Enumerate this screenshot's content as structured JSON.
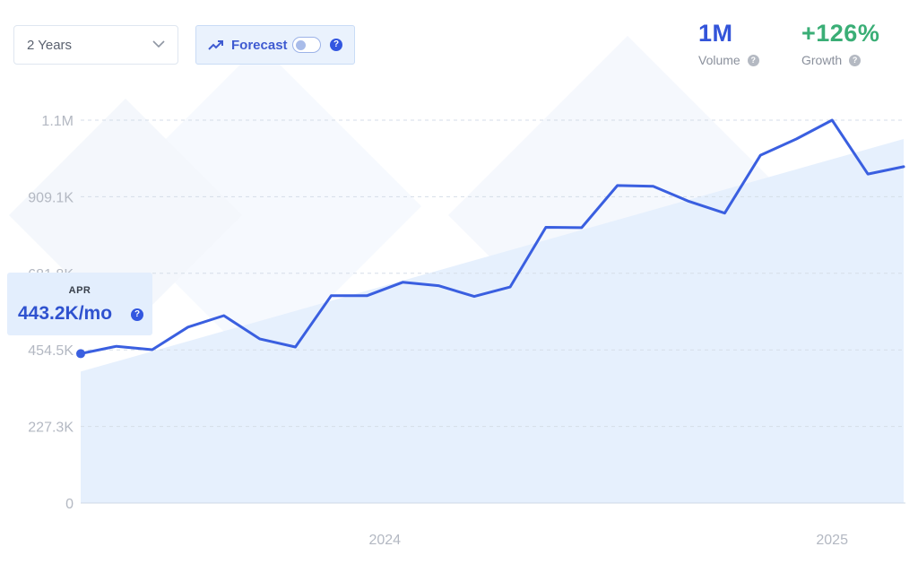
{
  "controls": {
    "range": {
      "selected": "2 Years",
      "icon": "chevron-down-icon"
    },
    "forecast": {
      "label": "Forecast",
      "enabled": false,
      "icon": "trending-up-icon",
      "help": "?"
    }
  },
  "stats": {
    "volume": {
      "value": "1M",
      "label": "Volume",
      "help": "?"
    },
    "growth": {
      "value": "+126%",
      "label": "Growth",
      "help": "?"
    }
  },
  "tooltip": {
    "month": "APR",
    "value": "443.2K/mo",
    "help": "?"
  },
  "colors": {
    "line": "#3a5fe0",
    "area": "#e6f0fd",
    "volume": "#3354d9",
    "growth": "#3aae76"
  },
  "chart_data": {
    "type": "line",
    "y_ticks": [
      "0",
      "227.3K",
      "454.5K",
      "681.8K",
      "909.1K",
      "1.1M"
    ],
    "x_ticks": [
      "2024",
      "2025"
    ],
    "ylim": [
      0,
      1136000
    ],
    "grid": true,
    "trend_area": {
      "start": 390000,
      "end": 1080000
    },
    "series": [
      {
        "values": [
          443200,
          465000,
          455000,
          522000,
          556000,
          487000,
          463000,
          615000,
          615000,
          655000,
          645000,
          613000,
          641000,
          818000,
          817000,
          942000,
          940000,
          895000,
          860000,
          1032000,
          1080000,
          1136000,
          976000,
          998000
        ]
      }
    ]
  }
}
